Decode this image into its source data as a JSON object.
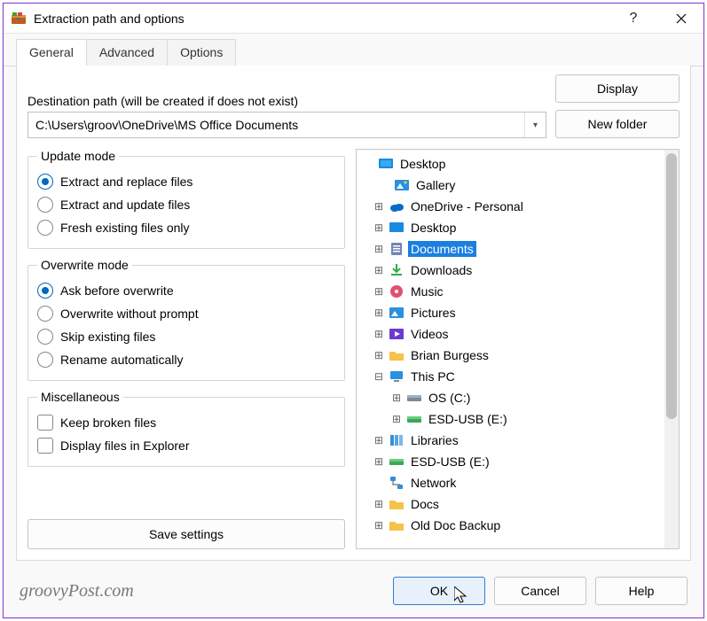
{
  "title": "Extraction path and options",
  "tabs": {
    "general": "General",
    "advanced": "Advanced",
    "options": "Options"
  },
  "dest": {
    "label": "Destination path (will be created if does not exist)",
    "value": "C:\\Users\\groov\\OneDrive\\MS Office Documents"
  },
  "buttons": {
    "display": "Display",
    "new_folder": "New folder",
    "save_settings": "Save settings",
    "ok": "OK",
    "cancel": "Cancel",
    "help": "Help"
  },
  "groups": {
    "update": {
      "legend": "Update mode",
      "opt1": "Extract and replace files",
      "opt2": "Extract and update files",
      "opt3": "Fresh existing files only"
    },
    "overwrite": {
      "legend": "Overwrite mode",
      "opt1": "Ask before overwrite",
      "opt2": "Overwrite without prompt",
      "opt3": "Skip existing files",
      "opt4": "Rename automatically"
    },
    "misc": {
      "legend": "Miscellaneous",
      "opt1": "Keep broken files",
      "opt2": "Display files in Explorer"
    }
  },
  "tree": {
    "desktop": "Desktop",
    "gallery": "Gallery",
    "onedrive": "OneDrive - Personal",
    "desktop2": "Desktop",
    "documents": "Documents",
    "downloads": "Downloads",
    "music": "Music",
    "pictures": "Pictures",
    "videos": "Videos",
    "brian": "Brian Burgess",
    "thispc": "This PC",
    "osc": "OS (C:)",
    "esdusb": "ESD-USB (E:)",
    "libraries": "Libraries",
    "esdusb2": "ESD-USB (E:)",
    "network": "Network",
    "docs": "Docs",
    "oldbackup": "Old Doc Backup"
  },
  "watermark": "groovyPost.com"
}
